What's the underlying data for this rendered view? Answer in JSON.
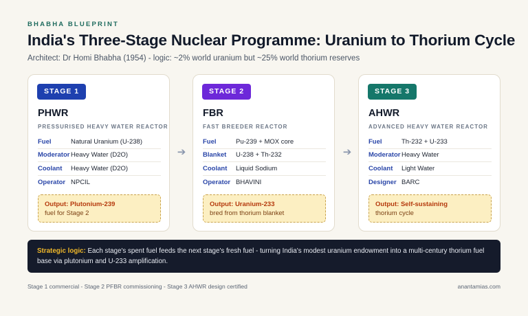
{
  "header": {
    "kicker": "BHABHA BLUEPRINT",
    "title": "India's Three-Stage Nuclear Programme: Uranium to Thorium Cycle",
    "subtitle": "Architect: Dr Homi Bhabha (1954) - logic: ~2% world uranium but ~25% world thorium reserves"
  },
  "arrow_icon": "arrow-right-icon",
  "stages": [
    {
      "badge": "STAGE 1",
      "badge_color": "#1e40af",
      "name": "PHWR",
      "full_name": "PRESSURISED HEAVY WATER REACTOR",
      "rows": [
        {
          "key": "Fuel",
          "value": "Natural Uranium (U-238)"
        },
        {
          "key": "Moderator",
          "value": "Heavy Water (D2O)"
        },
        {
          "key": "Coolant",
          "value": "Heavy Water (D2O)"
        },
        {
          "key": "Operator",
          "value": "NPCIL"
        }
      ],
      "output_label": "Output:",
      "output_line1": "Plutonium-239",
      "output_line2": "fuel for Stage 2"
    },
    {
      "badge": "STAGE 2",
      "badge_color": "#6d28d9",
      "name": "FBR",
      "full_name": "FAST BREEDER REACTOR",
      "rows": [
        {
          "key": "Fuel",
          "value": "Pu-239 + MOX core"
        },
        {
          "key": "Blanket",
          "value": "U-238 + Th-232"
        },
        {
          "key": "Coolant",
          "value": "Liquid Sodium"
        },
        {
          "key": "Operator",
          "value": "BHAVINI"
        }
      ],
      "output_label": "Output:",
      "output_line1": "Uranium-233",
      "output_line2": "bred from thorium blanket"
    },
    {
      "badge": "STAGE 3",
      "badge_color": "#15776a",
      "name": "AHWR",
      "full_name": "ADVANCED HEAVY WATER REACTOR",
      "rows": [
        {
          "key": "Fuel",
          "value": "Th-232 + U-233"
        },
        {
          "key": "Moderator",
          "value": "Heavy Water"
        },
        {
          "key": "Coolant",
          "value": "Light Water"
        },
        {
          "key": "Designer",
          "value": "BARC"
        }
      ],
      "output_label": "Output:",
      "output_line1": "Self-sustaining",
      "output_line2": "thorium cycle"
    }
  ],
  "logic": {
    "label": "Strategic logic:",
    "text": " Each stage's spent fuel feeds the next stage's fresh fuel - turning India's modest uranium endowment into a multi-century thorium fuel base via plutonium and U-233 amplification."
  },
  "footer": {
    "left": "Stage 1 commercial - Stage 2 PFBR commissioning - Stage 3 AHWR design certified",
    "right": "anantamias.com"
  }
}
